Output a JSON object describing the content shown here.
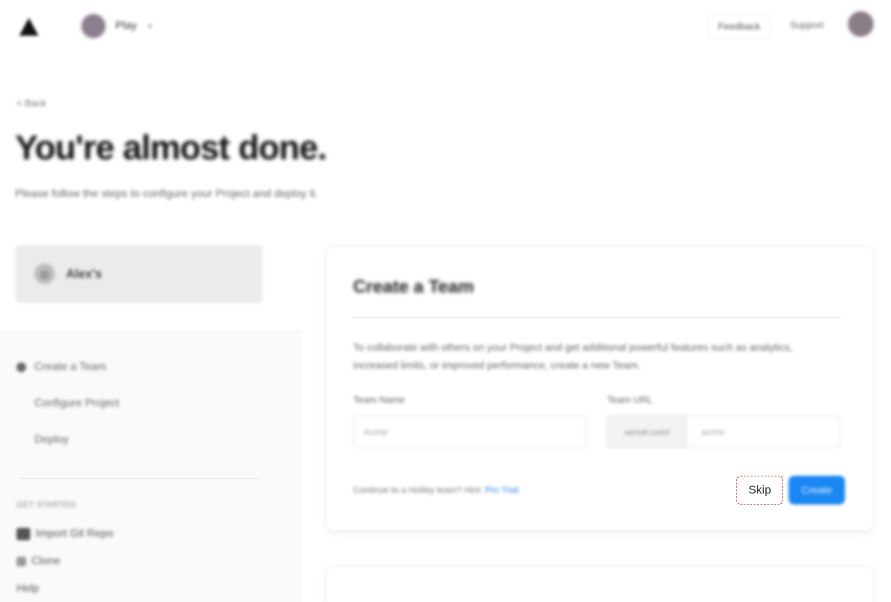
{
  "header": {
    "workspace_name": "Play",
    "feedback_label": "Feedback",
    "support_label": "Support"
  },
  "page": {
    "back_label": "< Back",
    "title": "You're almost done.",
    "subtitle": "Please follow the steps to configure your Project and deploy it."
  },
  "sidebar": {
    "current_card_label": "Alex's",
    "steps": [
      {
        "label": "Create a Team",
        "active": true
      },
      {
        "label": "Configure Project",
        "active": false
      },
      {
        "label": "Deploy",
        "active": false
      }
    ],
    "resources_heading": "GET STARTED",
    "resources": [
      {
        "label": "Import Git Repo",
        "icon": "folder-icon"
      },
      {
        "label": "Clone",
        "icon": "clone-icon"
      },
      {
        "label": "Help",
        "icon": "help-icon"
      }
    ]
  },
  "card": {
    "title": "Create a Team",
    "description": "To collaborate with others on your Project and get additional powerful features such as analytics, increased limits, or improved performance, create a new Team.",
    "team_name_label": "Team Name",
    "team_name_placeholder": "Acme",
    "team_url_label": "Team URL",
    "team_url_prefix": "vercel.com/",
    "team_url_placeholder": "acme",
    "footer_text": "Continue to a Hobby team? Hint:",
    "footer_link": "Pro Trial",
    "skip_label": "Skip",
    "create_label": "Create"
  },
  "colors": {
    "primary": "#1a86f2",
    "skip_outline": "#c0392b"
  }
}
